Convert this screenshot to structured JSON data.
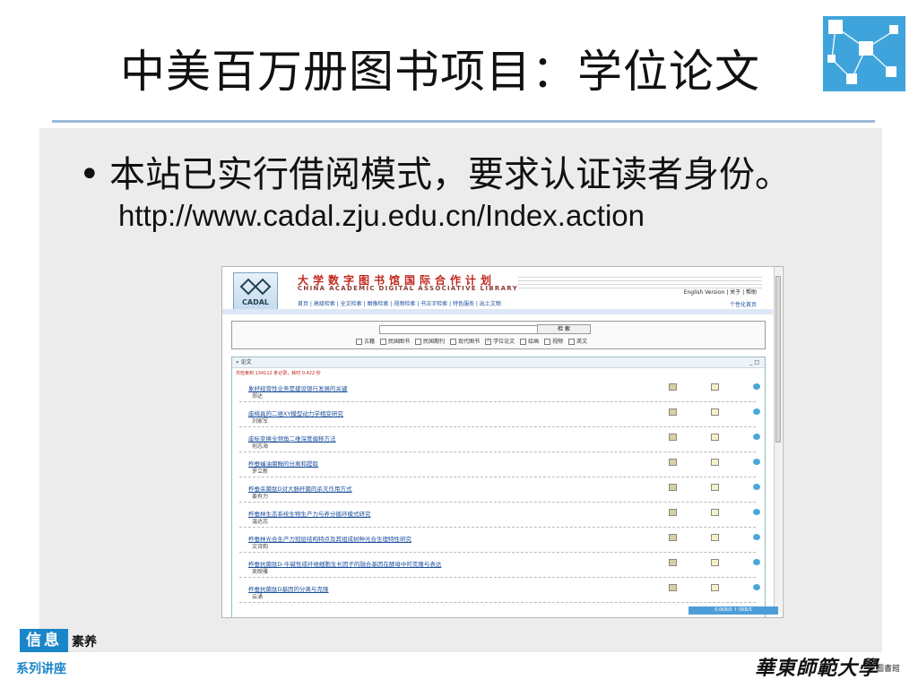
{
  "slide": {
    "title": "中美百万册图书项目：学位论文",
    "bullet": "本站已实行借阅模式，要求认证读者身份。",
    "url": "http://www.cadal.zju.edu.cn/Index.action"
  },
  "site": {
    "logo_text": "CADAL",
    "name_cn": "大学数字图书馆国际合作计划",
    "name_en": "CHINA ACADEMIC DIGITAL ASSOCIATIVE LIBRARY",
    "nav": "首页 | 高级检索 | 全文检索 | 图像检索 | 视频检索 | 书法字检索 | 特色服务 | 出土文物",
    "top_links": "English Version | 关于 | 帮助",
    "personal": "个性化首页",
    "search_button": "检  索",
    "types": [
      {
        "label": "古籍",
        "checked": false
      },
      {
        "label": "民国图书",
        "checked": false
      },
      {
        "label": "民国期刊",
        "checked": false
      },
      {
        "label": "现代图书",
        "checked": false
      },
      {
        "label": "学位论文",
        "checked": true
      },
      {
        "label": "绘画",
        "checked": false
      },
      {
        "label": "视频",
        "checked": false
      },
      {
        "label": "英文",
        "checked": false
      }
    ],
    "results_header": "论文",
    "results_controls": "_ □",
    "result_count": "共检索到 134112 条记录，耗时 0.422 秒",
    "results": [
      {
        "title": "象好经营性业务是建设银行发展的关键",
        "author": "郑达"
      },
      {
        "title": "座椅具的二维XY模型动力学相变研究",
        "author": "刘家军"
      },
      {
        "title": "座标变换全频角二维深度偏移方法",
        "author": "何志海"
      },
      {
        "title": "柞蚕蛹油菌酶的分离和提取",
        "author": "罗立新"
      },
      {
        "title": "柞蚕杀菌肽D对大肠杆菌的杀灭作用方式",
        "author": "姜有力"
      },
      {
        "title": "柞蚕林生态系统生物生产力与养分循环模式研究",
        "author": "温达志"
      },
      {
        "title": "柞蚕林光合生产力冠层结构特点及其组成树种光合生理特性研究",
        "author": "文诗韵"
      },
      {
        "title": "柞蚕抗菌肽D-牛碱性成纤维细胞生长因子的融合基因在酵母中的克隆与表达",
        "author": "吴映雅"
      },
      {
        "title": "柞蚕抗菌肽D基因的分离与克隆",
        "author": "云涌"
      }
    ],
    "status": "0.0KB/S  ↑  0KB/S"
  },
  "brand": {
    "badge": "信息",
    "badge_suffix": "素养",
    "series": "系列讲座",
    "university": "華東師範大學",
    "university_sub": "圖書館"
  },
  "colors": {
    "accent": "#1a86c8",
    "rule": "#9bbbd8",
    "content_bg": "#ececec",
    "link": "#1b4f9c",
    "brand_red": "#c0261c"
  }
}
